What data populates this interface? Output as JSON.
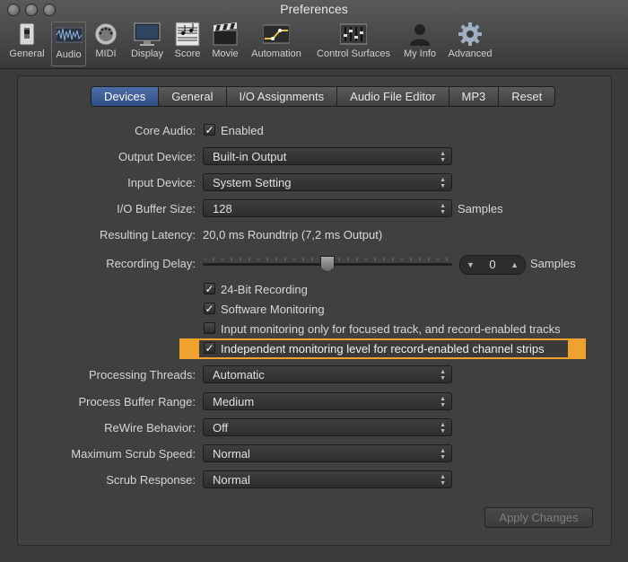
{
  "window": {
    "title": "Preferences"
  },
  "toolbar": {
    "items": [
      {
        "label": "General",
        "icon": "switch-icon"
      },
      {
        "label": "Audio",
        "icon": "audio-waveform-icon"
      },
      {
        "label": "MIDI",
        "icon": "midi-connector-icon"
      },
      {
        "label": "Display",
        "icon": "monitor-icon"
      },
      {
        "label": "Score",
        "icon": "score-sheet-icon"
      },
      {
        "label": "Movie",
        "icon": "clapperboard-icon"
      },
      {
        "label": "Automation",
        "icon": "automation-curve-icon"
      },
      {
        "label": "Control Surfaces",
        "icon": "faders-icon"
      },
      {
        "label": "My Info",
        "icon": "person-icon"
      },
      {
        "label": "Advanced",
        "icon": "gear-icon"
      }
    ],
    "active": "Audio"
  },
  "tabs": [
    {
      "label": "Devices",
      "selected": true
    },
    {
      "label": "General"
    },
    {
      "label": "I/O Assignments"
    },
    {
      "label": "Audio File Editor"
    },
    {
      "label": "MP3"
    },
    {
      "label": "Reset"
    }
  ],
  "settings": {
    "core_audio_label": "Core Audio:",
    "core_audio_enabled": "Enabled",
    "output_device_label": "Output Device:",
    "output_device_value": "Built-in Output",
    "input_device_label": "Input Device:",
    "input_device_value": "System Setting",
    "io_buffer_label": "I/O Buffer Size:",
    "io_buffer_value": "128",
    "io_buffer_unit": "Samples",
    "latency_label": "Resulting Latency:",
    "latency_value": "20,0 ms Roundtrip (7,2 ms Output)",
    "recording_delay_label": "Recording Delay:",
    "recording_delay_value": "0",
    "recording_delay_unit": "Samples",
    "checkboxes": [
      {
        "label": "24-Bit Recording",
        "checked": true
      },
      {
        "label": "Software Monitoring",
        "checked": true
      },
      {
        "label": "Input monitoring only for focused track, and record-enabled tracks",
        "checked": false
      },
      {
        "label": "Independent monitoring level for record-enabled channel strips",
        "checked": true
      }
    ],
    "processing_threads_label": "Processing Threads:",
    "processing_threads_value": "Automatic",
    "process_buffer_label": "Process Buffer Range:",
    "process_buffer_value": "Medium",
    "rewire_label": "ReWire Behavior:",
    "rewire_value": "Off",
    "scrub_speed_label": "Maximum Scrub Speed:",
    "scrub_speed_value": "Normal",
    "scrub_response_label": "Scrub Response:",
    "scrub_response_value": "Normal"
  },
  "footer": {
    "apply_label": "Apply Changes"
  },
  "colors": {
    "highlight": "#f0a22f",
    "tab_selected": "#3a5c96"
  }
}
